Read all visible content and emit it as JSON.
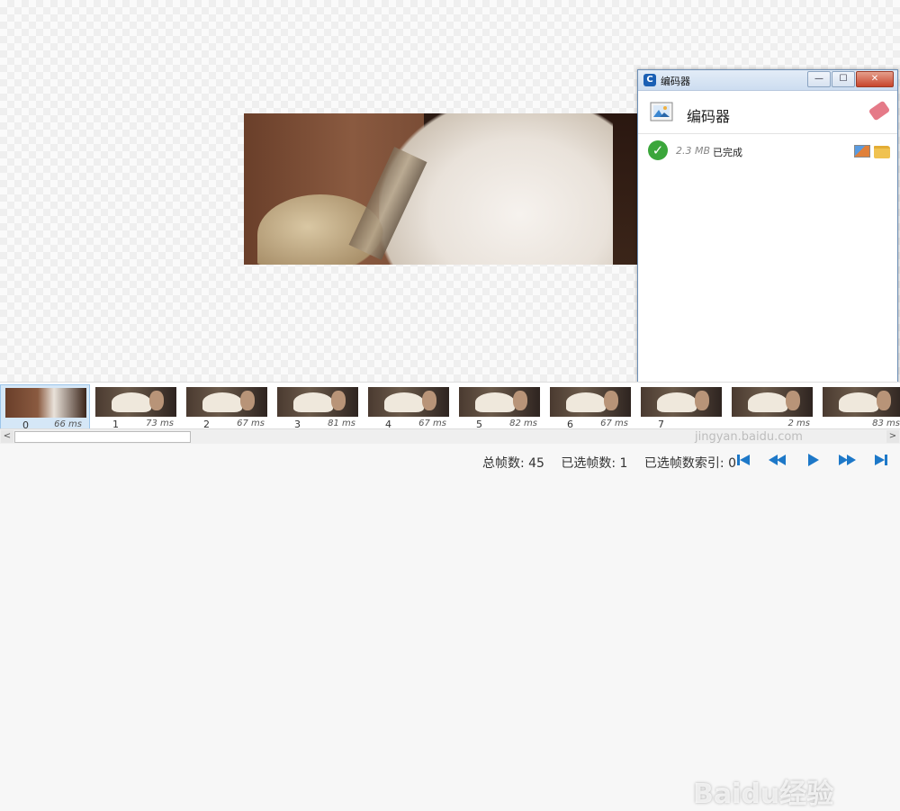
{
  "encoder_window": {
    "title": "编码器",
    "app_icon_letter": "C",
    "controls": {
      "minimize": "—",
      "maximize": "☐",
      "close": "✕"
    },
    "header_label": "编码器",
    "items": [
      {
        "size": "2.3 MB",
        "status": "已完成"
      }
    ]
  },
  "frames": [
    {
      "index": "0",
      "duration": "66 ms",
      "selected": true
    },
    {
      "index": "1",
      "duration": "73 ms"
    },
    {
      "index": "2",
      "duration": "67 ms"
    },
    {
      "index": "3",
      "duration": "81 ms"
    },
    {
      "index": "4",
      "duration": "67 ms"
    },
    {
      "index": "5",
      "duration": "82 ms"
    },
    {
      "index": "6",
      "duration": "67 ms"
    },
    {
      "index": "7",
      "duration": ""
    },
    {
      "index": "",
      "duration": "2 ms"
    },
    {
      "index": "",
      "duration": "83 ms"
    }
  ],
  "status": {
    "total_frames": "总帧数: 45",
    "selected_frames": "已选帧数: 1",
    "selected_index": "已选帧数索引: 0"
  },
  "scroll": {
    "left_arrow": "<",
    "right_arrow": ">"
  },
  "watermark": {
    "text": "Baidu经验",
    "sub": "jingyan.baidu.com"
  },
  "colors": {
    "accent": "#1d78c8",
    "success": "#3ba63b",
    "selection": "#d5e7f7"
  }
}
